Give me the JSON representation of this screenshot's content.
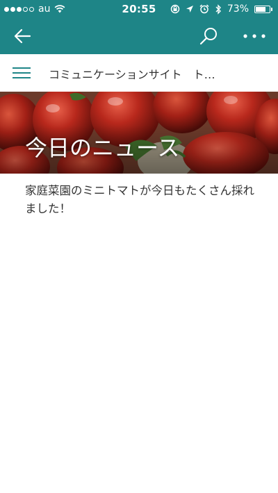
{
  "status_bar": {
    "carrier": "au",
    "time": "20:55",
    "battery_percent_label": "73%",
    "battery_level": 0.73,
    "signal_bars_filled": 3,
    "signal_bars_total": 5
  },
  "app_bar": {
    "background_color": "#1e8587",
    "back_icon": "arrow-left-icon",
    "search_icon": "search-icon",
    "more_icon": "more-dots-icon"
  },
  "site_header": {
    "menu_icon": "hamburger-menu-icon",
    "title": "コミュニケーションサイト　ト…"
  },
  "hero": {
    "title": "今日のニュース"
  },
  "article": {
    "body": "家庭菜園のミニトマトが今日もたくさん採れました！"
  }
}
